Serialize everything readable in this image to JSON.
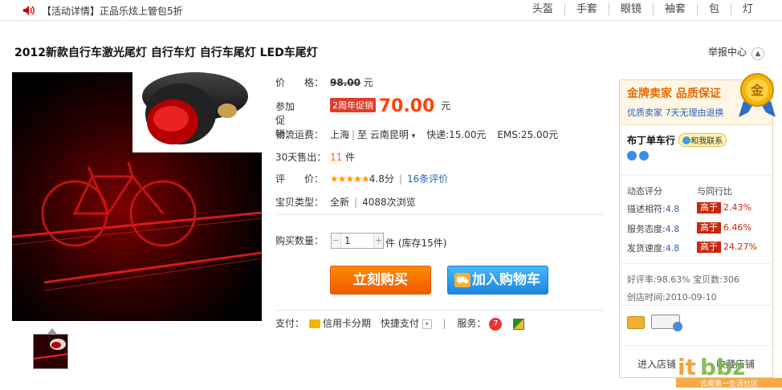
{
  "topbar": {
    "notice": "【活动详情】正品乐炫上管包5折",
    "categories": [
      "头盔",
      "手套",
      "眼镜",
      "袖套",
      "包",
      "灯"
    ]
  },
  "title": "2012新款自行车激光尾灯 自行车灯 自行车尾灯 LED车尾灯",
  "report": "举报中心",
  "price": {
    "label": "价　　格：",
    "original": "98.00",
    "unit": "元",
    "promo_label": "参加促销：",
    "promo_tag": "2周年促销",
    "promo_price": "70.00",
    "promo_unit": "元"
  },
  "shipping": {
    "label": "物流运费：",
    "from": "上海",
    "to_prefix": "至",
    "to": "云南昆明",
    "express": "快递:15.00元",
    "ems": "EMS:25.00元"
  },
  "sales": {
    "label": "30天售出：",
    "count": "11",
    "unit": "件"
  },
  "rating": {
    "label": "评　　价：",
    "stars": "★★★★★",
    "score": "4.8分",
    "reviews": "16条评价"
  },
  "item_type": {
    "label": "宝贝类型：",
    "condition": "全新",
    "views": "4088次浏览"
  },
  "quantity": {
    "label": "购买数量：",
    "value": "1",
    "stock": "件 (库存15件)"
  },
  "buttons": {
    "buy_now": "立刻购买",
    "add_cart": "加入购物车"
  },
  "payment": {
    "label": "支付：",
    "credit": "信用卡分期",
    "quick": "快捷支付",
    "service_label": "服务："
  },
  "seller": {
    "badge": "金牌卖家 品质保证",
    "sub": "优质卖家 7天无理由退换",
    "medal": "金",
    "shop_name": "布丁单车行",
    "contact": "和我联系",
    "dynamic_label": "动态评分",
    "compare_label": "与同行比",
    "scores": [
      {
        "name": "描述相符:",
        "value": "4.8",
        "tag": "高于",
        "pct": "2.43%"
      },
      {
        "name": "服务态度:",
        "value": "4.8",
        "tag": "高于",
        "pct": "6.46%"
      },
      {
        "name": "发货速度:",
        "value": "4.8",
        "tag": "高于",
        "pct": "24.27%"
      }
    ],
    "good_rate": "好评率:98.63%",
    "items_count": "宝贝数:306",
    "created": "创店时间:2010-09-10",
    "enter_shop": "进入店铺",
    "fav_shop": "收藏店铺"
  },
  "watermark": {
    "logo": "itbbz.com",
    "slogan": "云南第一生活社区"
  }
}
